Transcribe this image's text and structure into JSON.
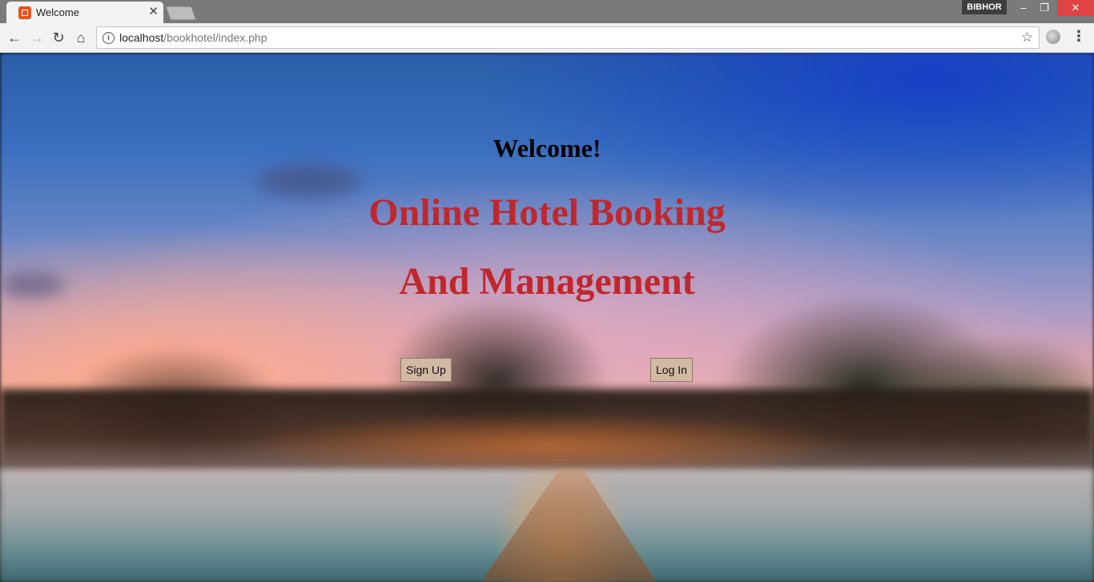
{
  "browser": {
    "tab_title": "Welcome",
    "tab_close": "✕",
    "profile_name": "BIBHOR",
    "window_controls": {
      "minimize": "–",
      "maximize": "❐",
      "close": "✕"
    },
    "nav": {
      "back": "←",
      "forward": "→",
      "reload": "↻",
      "home": "⌂"
    },
    "url_host": "localhost",
    "url_path": "/bookhotel/index.php",
    "star": "☆",
    "menu": "⋮"
  },
  "page": {
    "welcome": "Welcome!",
    "headline_line1": "Online Hotel Booking",
    "headline_line2": "And Management",
    "signup_label": "Sign Up",
    "login_label": "Log In"
  },
  "colors": {
    "headline": "#c0272d",
    "button_bg": "#d2b9a4"
  }
}
